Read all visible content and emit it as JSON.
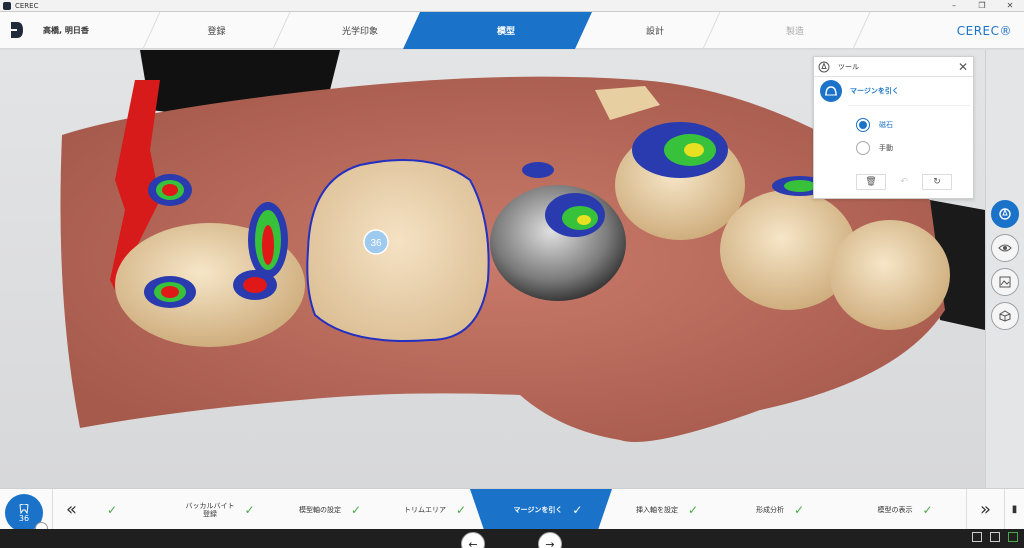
{
  "window": {
    "title": "CEREC"
  },
  "header": {
    "patient_name": "高橋, 明日香",
    "brand": "CEREC®",
    "steps": [
      {
        "label": "登録",
        "state": "done"
      },
      {
        "label": "光学印象",
        "state": "done"
      },
      {
        "label": "模型",
        "state": "active"
      },
      {
        "label": "設計",
        "state": "todo"
      },
      {
        "label": "製造",
        "state": "disabled"
      }
    ]
  },
  "viewport": {
    "tooth_label": "36"
  },
  "tools_panel": {
    "title": "ツール",
    "tool_label": "マージンを引く",
    "options": [
      {
        "label": "磁石",
        "selected": true
      },
      {
        "label": "手動",
        "selected": false
      }
    ],
    "actions": [
      "delete-icon",
      "undo-icon",
      "reset-icon"
    ]
  },
  "side_tools": [
    "tools-icon",
    "eye-icon",
    "image-icon",
    "model-icon"
  ],
  "phasebar": {
    "tooth_number": "36",
    "phases": [
      {
        "label": "",
        "done": true
      },
      {
        "label": "バッカルバイト\n登録",
        "done": true
      },
      {
        "label": "模型軸の設定",
        "done": true
      },
      {
        "label": "トリムエリア",
        "done": true
      },
      {
        "label": "マージンを引く",
        "done": true,
        "active": true
      },
      {
        "label": "挿入軸を設定",
        "done": true
      },
      {
        "label": "形成分析",
        "done": true
      },
      {
        "label": "模型の表示",
        "done": true
      }
    ]
  },
  "colors": {
    "accent": "#1a73c8",
    "check": "#4aa84a"
  }
}
